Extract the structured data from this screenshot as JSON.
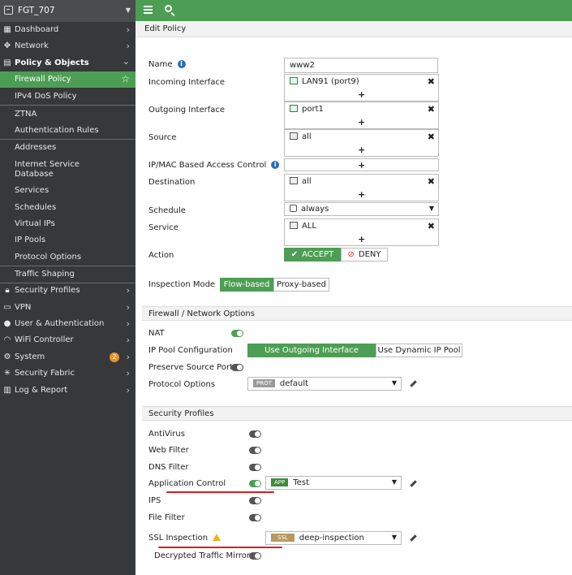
{
  "sidebar": {
    "host": "FGT_707",
    "items": [
      {
        "label": "Dashboard",
        "icon": "dashboard-icon",
        "chevron": "›"
      },
      {
        "label": "Network",
        "icon": "network-icon",
        "chevron": "›"
      },
      {
        "label": "Policy & Objects",
        "icon": "policy-icon",
        "chevron": "⌄"
      },
      {
        "label": "Firewall Policy",
        "star": "☆"
      },
      {
        "label": "IPv4 DoS Policy"
      },
      {
        "label": "ZTNA"
      },
      {
        "label": "Authentication Rules"
      },
      {
        "label": "Addresses"
      },
      {
        "label": "Internet Service Database"
      },
      {
        "label": "Services"
      },
      {
        "label": "Schedules"
      },
      {
        "label": "Virtual IPs"
      },
      {
        "label": "IP Pools"
      },
      {
        "label": "Protocol Options"
      },
      {
        "label": "Traffic Shaping"
      },
      {
        "label": "Security Profiles",
        "icon": "lock-icon",
        "chevron": "›"
      },
      {
        "label": "VPN",
        "icon": "vpn-icon",
        "chevron": "›"
      },
      {
        "label": "User & Authentication",
        "icon": "user-icon",
        "chevron": "›"
      },
      {
        "label": "WiFi Controller",
        "icon": "wifi-icon",
        "chevron": "›"
      },
      {
        "label": "System",
        "icon": "gear-icon",
        "chevron": "›",
        "badge": "2"
      },
      {
        "label": "Security Fabric",
        "icon": "fabric-icon",
        "chevron": "›"
      },
      {
        "label": "Log & Report",
        "icon": "report-icon",
        "chevron": "›"
      }
    ]
  },
  "page": {
    "title": "Edit Policy"
  },
  "form": {
    "name_label": "Name",
    "name_value": "www2",
    "incoming_label": "Incoming Interface",
    "incoming_value": "LAN91 (port9)",
    "outgoing_label": "Outgoing Interface",
    "outgoing_value": "port1",
    "source_label": "Source",
    "source_value": "all",
    "ipmac_label": "IP/MAC Based Access Control",
    "destination_label": "Destination",
    "destination_value": "all",
    "schedule_label": "Schedule",
    "schedule_value": "always",
    "service_label": "Service",
    "service_value": "ALL",
    "action_label": "Action",
    "accept": "ACCEPT",
    "deny": "DENY",
    "inspection_label": "Inspection Mode",
    "flow": "Flow-based",
    "proxy": "Proxy-based",
    "plus": "+",
    "remove": "✖",
    "info": "i"
  },
  "fw": {
    "title": "Firewall / Network Options",
    "nat_label": "NAT",
    "pool_label": "IP Pool Configuration",
    "pool_opt1": "Use Outgoing Interface Address",
    "pool_opt2": "Use Dynamic IP Pool",
    "preserve_label": "Preserve Source Port",
    "protocol_label": "Protocol Options",
    "protocol_tag": "PROT",
    "protocol_value": "default"
  },
  "sec": {
    "title": "Security Profiles",
    "antivirus": "AntiVirus",
    "webfilter": "Web Filter",
    "dnsfilter": "DNS Filter",
    "appcontrol": "Application Control",
    "app_tag": "APP",
    "app_value": "Test",
    "ips": "IPS",
    "filefilter": "File Filter",
    "ssl_label": "SSL Inspection",
    "ssl_tag": "SSL",
    "ssl_value": "deep-inspection",
    "decrypted": "Decrypted Traffic Mirror"
  },
  "colors": {
    "accent": "#4d9e54",
    "sidebar": "#363839",
    "annotation": "#d62020"
  }
}
